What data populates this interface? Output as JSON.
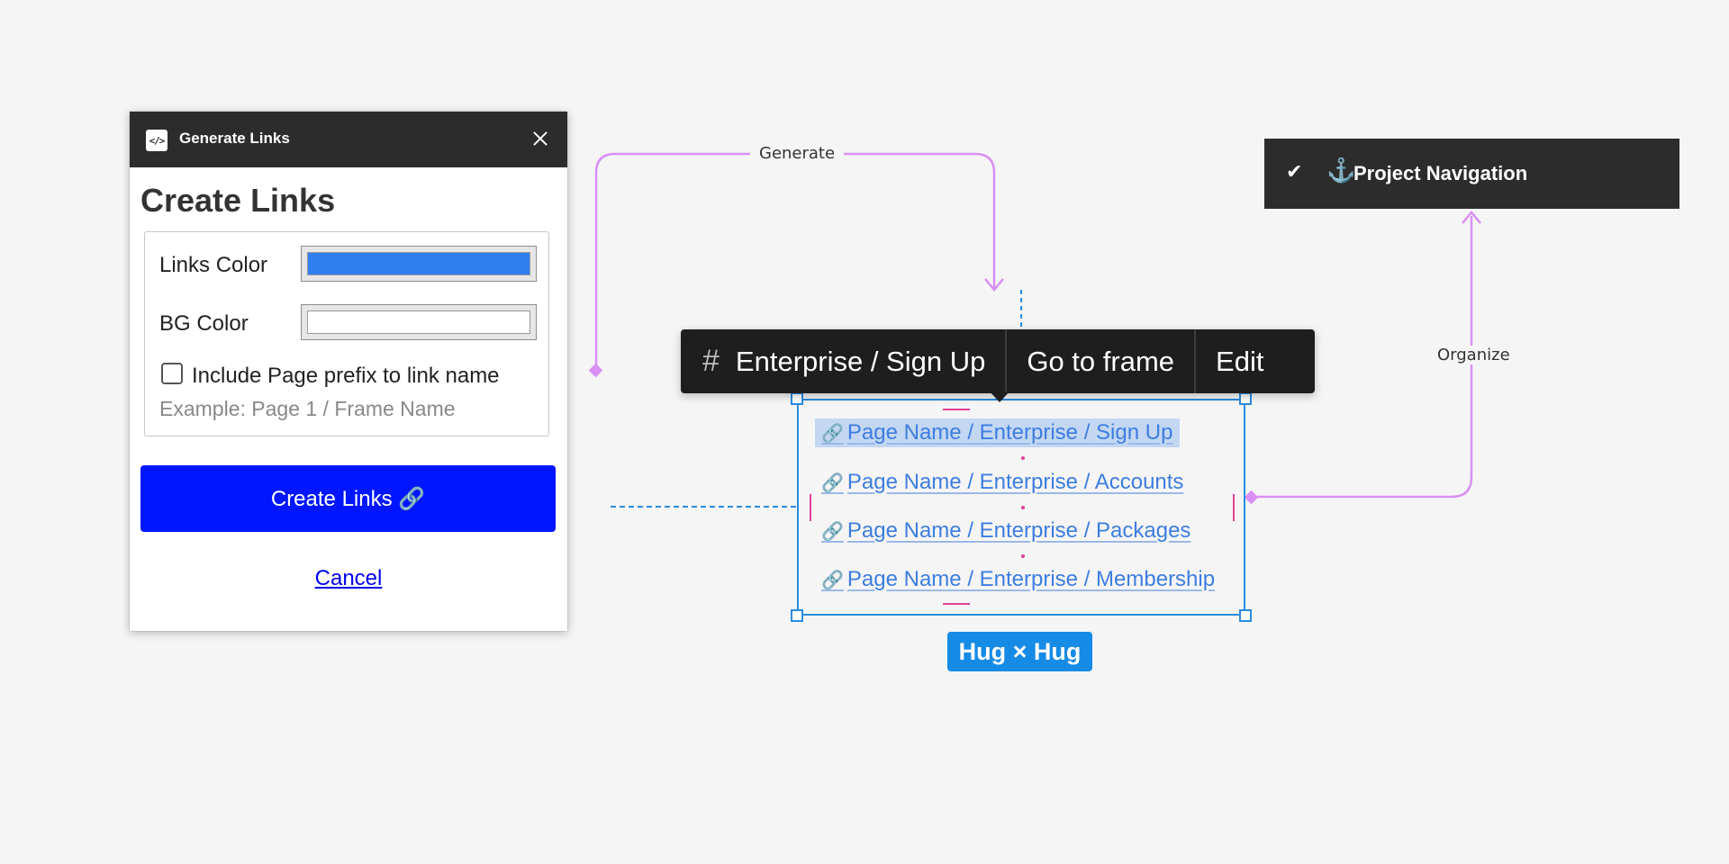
{
  "dialog": {
    "title": "Generate Links",
    "heading": "Create Links",
    "links_color_label": "Links Color",
    "links_color_value": "#2f7ff0",
    "bg_color_label": "BG Color",
    "bg_color_value": "#ffffff",
    "prefix_checkbox_label": "Include Page prefix to link name",
    "prefix_checked": false,
    "example_text": "Example: Page 1 / Frame Name",
    "create_button_label": "Create Links 🔗",
    "cancel_label": "Cancel",
    "plugin_icon": "</>",
    "close_icon": "close-icon"
  },
  "connectors": {
    "generate_label": "Generate",
    "organize_label": "Organize",
    "color": "#d98ff5"
  },
  "nav": {
    "check": "✔",
    "anchor": "⚓",
    "label": "Project Navigation"
  },
  "toolbar": {
    "frame_icon": "#",
    "frame_name": "Enterprise / Sign Up",
    "go_to_frame_label": "Go to frame",
    "edit_label": "Edit"
  },
  "links": {
    "items": [
      {
        "label": "Page Name / Enterprise / Sign Up",
        "selected": true
      },
      {
        "label": "Page Name / Enterprise / Accounts",
        "selected": false
      },
      {
        "label": "Page Name / Enterprise / Packages",
        "selected": false
      },
      {
        "label": "Page Name / Enterprise / Membership",
        "selected": false
      }
    ],
    "chain_icon": "🔗"
  },
  "sizing_badge": "Hug × Hug",
  "selection_color": "#2a8be0"
}
